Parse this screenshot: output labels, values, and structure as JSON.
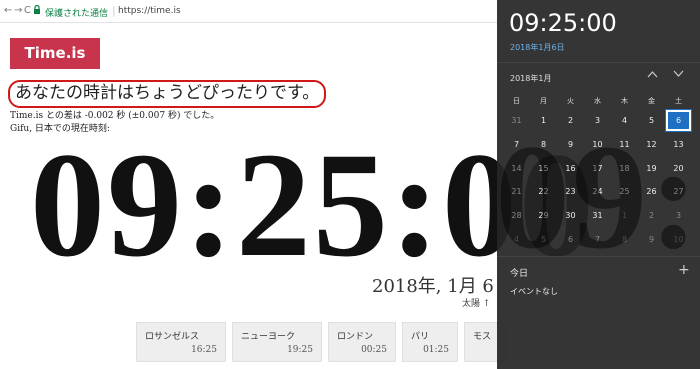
{
  "browser": {
    "nav_back": "←",
    "nav_forward": "→",
    "nav_reload": "C",
    "secure_label": "保護された通信",
    "url": "https://time.is"
  },
  "page": {
    "logo": "Time.is",
    "headline": "あなたの時計はちょうどぴったりです。",
    "offset_text": "Time.is との差は -0.002 秒 (±0.007 秒) でした。",
    "location_text": "Gifu, 日本での現在時刻:",
    "clock": "09:25:00",
    "date": "2018年, 1月 6",
    "sun": "太陽 ↑",
    "cities": [
      {
        "name": "ロサンゼルス",
        "time": "16:25"
      },
      {
        "name": "ニューヨーク",
        "time": "19:25"
      },
      {
        "name": "ロンドン",
        "time": "00:25"
      },
      {
        "name": "パリ",
        "time": "01:25"
      },
      {
        "name": "モス",
        "time": ""
      }
    ]
  },
  "flyout": {
    "time": "09:25:00",
    "date": "2018年1月6日",
    "month": "2018年1月",
    "weekdays": [
      "日",
      "月",
      "火",
      "水",
      "木",
      "金",
      "土"
    ],
    "weeks": [
      [
        {
          "d": "31",
          "dim": true
        },
        {
          "d": "1"
        },
        {
          "d": "2"
        },
        {
          "d": "3"
        },
        {
          "d": "4"
        },
        {
          "d": "5"
        },
        {
          "d": "6",
          "today": true
        }
      ],
      [
        {
          "d": "7"
        },
        {
          "d": "8"
        },
        {
          "d": "9"
        },
        {
          "d": "10"
        },
        {
          "d": "11"
        },
        {
          "d": "12"
        },
        {
          "d": "13"
        }
      ],
      [
        {
          "d": "14"
        },
        {
          "d": "15"
        },
        {
          "d": "16"
        },
        {
          "d": "17"
        },
        {
          "d": "18"
        },
        {
          "d": "19"
        },
        {
          "d": "20"
        }
      ],
      [
        {
          "d": "21"
        },
        {
          "d": "22"
        },
        {
          "d": "23"
        },
        {
          "d": "24"
        },
        {
          "d": "25"
        },
        {
          "d": "26"
        },
        {
          "d": "27"
        }
      ],
      [
        {
          "d": "28"
        },
        {
          "d": "29"
        },
        {
          "d": "30"
        },
        {
          "d": "31"
        },
        {
          "d": "1",
          "dim": true
        },
        {
          "d": "2",
          "dim": true
        },
        {
          "d": "3",
          "dim": true
        }
      ],
      [
        {
          "d": "4",
          "dim": true
        },
        {
          "d": "5",
          "dim": true
        },
        {
          "d": "6",
          "dim": true
        },
        {
          "d": "7",
          "dim": true
        },
        {
          "d": "8",
          "dim": true
        },
        {
          "d": "9",
          "dim": true
        },
        {
          "d": "10",
          "dim": true
        }
      ]
    ],
    "today_label": "今日",
    "add_label": "+",
    "no_events": "イベントなし",
    "prev_icon": "chevron-up-icon",
    "next_icon": "chevron-down-icon"
  },
  "colors": {
    "logo_bg": "#c8344c",
    "highlight_circle": "#d01818",
    "today_bg": "#1f6fc4",
    "flyout_bg": "#262626",
    "date_link": "#6fb1e8"
  }
}
